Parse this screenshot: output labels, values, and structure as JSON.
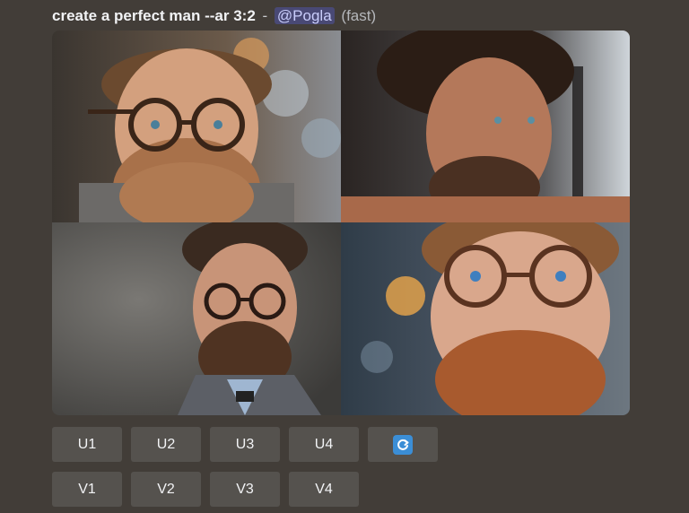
{
  "message": {
    "prompt": "create a perfect man --ar 3:2",
    "separator": "-",
    "mention": "@Pogla",
    "mode": "(fast)"
  },
  "grid": {
    "images": [
      {
        "name": "portrait-glasses-beard-1"
      },
      {
        "name": "portrait-beard-profile-2"
      },
      {
        "name": "portrait-glasses-suit-3"
      },
      {
        "name": "portrait-glasses-closeup-4"
      }
    ]
  },
  "buttons": {
    "upscale": [
      "U1",
      "U2",
      "U3",
      "U4"
    ],
    "variation": [
      "V1",
      "V2",
      "V3",
      "V4"
    ],
    "reroll_icon": "refresh-icon"
  },
  "colors": {
    "background": "#423d38",
    "button": "#55524e",
    "reroll_accent": "#3b8ed6",
    "mention_bg": "#5865f2"
  }
}
